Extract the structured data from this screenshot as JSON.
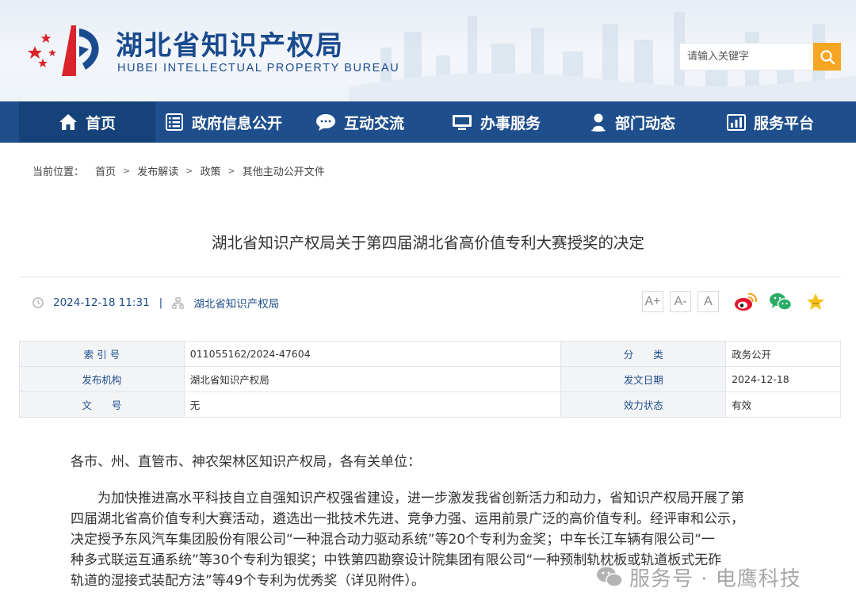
{
  "header": {
    "title": "湖北省知识产权局",
    "subtitle": "HUBEI INTELLECTUAL PROPERTY BUREAU",
    "search_placeholder": "请输入关键字"
  },
  "nav": {
    "items": [
      {
        "label": "首页",
        "icon": "home-icon"
      },
      {
        "label": "政府信息公开",
        "icon": "document-list-icon"
      },
      {
        "label": "互动交流",
        "icon": "chat-bubble-icon"
      },
      {
        "label": "办事服务",
        "icon": "monitor-icon"
      },
      {
        "label": "部门动态",
        "icon": "person-pin-icon"
      },
      {
        "label": "服务平台",
        "icon": "bar-chart-icon"
      }
    ]
  },
  "breadcrumb": {
    "prefix": "当前位置：",
    "items": [
      "首页",
      "发布解读",
      "政策",
      "其他主动公开文件"
    ],
    "separator": ">"
  },
  "article": {
    "title": "湖北省知识产权局关于第四届湖北省高价值专利大赛授奖的决定",
    "datetime": "2024-12-18 11:31",
    "meta_separator": "|",
    "source": "湖北省知识产权局"
  },
  "font_size_buttons": [
    "A+",
    "A-",
    "A"
  ],
  "share": [
    "weibo-icon",
    "wechat-icon",
    "favorite-star-icon"
  ],
  "info_table": {
    "rows": [
      [
        {
          "label": "索 引 号",
          "value": "011055162/2024-47604"
        },
        {
          "label": "分　　类",
          "value": "政务公开"
        }
      ],
      [
        {
          "label": "发布机构",
          "value": "湖北省知识产权局"
        },
        {
          "label": "发文日期",
          "value": "2024-12-18"
        }
      ],
      [
        {
          "label": "文　　号",
          "value": "无"
        },
        {
          "label": "效力状态",
          "value": "有效"
        }
      ]
    ]
  },
  "body": {
    "greeting": "各市、州、直管市、神农架林区知识产权局，各有关单位：",
    "lines": [
      "为加快推进高水平科技自立自强知识产权强省建设，进一步激发我省创新活力和动力，省知识产权局开展了第",
      "四届湖北省高价值专利大赛活动，遴选出一批技术先进、竞争力强、运用前景广泛的高价值专利。经评审和公示，",
      "决定授予东风汽车集团股份有限公司“一种混合动力驱动系统”等20个专利为金奖；中车长江车辆有限公司“一",
      "种多式联运互通系统”等30个专利为银奖；中铁第四勘察设计院集团有限公司“一种预制轨枕板或轨道板式无砟",
      "轨道的湿接式装配方法”等49个专利为优秀奖（详见附件）。"
    ]
  },
  "watermark": "服务号 · 电鹰科技",
  "colors": {
    "nav_blue": "#1e4e8c",
    "brand_blue": "#1a4b8f",
    "search_orange": "#f5a623",
    "logo_red": "#d8242a"
  }
}
